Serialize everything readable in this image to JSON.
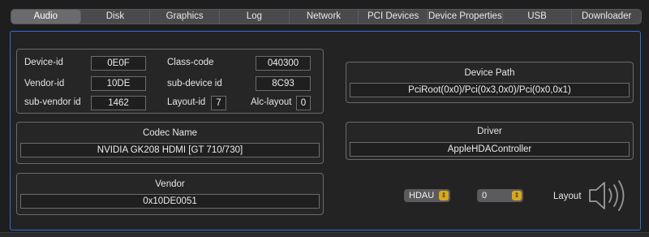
{
  "tabs": [
    "Audio",
    "Disk",
    "Graphics",
    "Log",
    "Network",
    "PCI Devices",
    "Device Properties",
    "USB",
    "Downloader"
  ],
  "ids": {
    "device_id_label": "Device-id",
    "device_id_value": "0E0F",
    "class_code_label": "Class-code",
    "class_code_value": "040300",
    "vendor_id_label": "Vendor-id",
    "vendor_id_value": "10DE",
    "sub_device_id_label": "sub-device id",
    "sub_device_id_value": "8C93",
    "sub_vendor_id_label": "sub-vendor id",
    "sub_vendor_id_value": "1462",
    "layout_id_label": "Layout-id",
    "layout_id_value": "7",
    "alc_layout_label": "Alc-layout",
    "alc_layout_value": "0"
  },
  "codec": {
    "title": "Codec Name",
    "value": "NVIDIA GK208 HDMI [GT 710/730]"
  },
  "vendor": {
    "title": "Vendor",
    "value": "0x10DE0051"
  },
  "device_path": {
    "title": "Device Path",
    "value": "PciRoot(0x0)/Pci(0x3,0x0)/Pci(0x0,0x1)"
  },
  "driver": {
    "title": "Driver",
    "value": "AppleHDAController"
  },
  "controls": {
    "codec_select": "HDAU",
    "layout_select": "0",
    "layout_label": "Layout"
  },
  "icons": {
    "speaker": "speaker-icon",
    "stepper": "stepper-icon"
  },
  "colors": {
    "accent": "#2f6fd6",
    "stepper": "#d9a91c"
  }
}
